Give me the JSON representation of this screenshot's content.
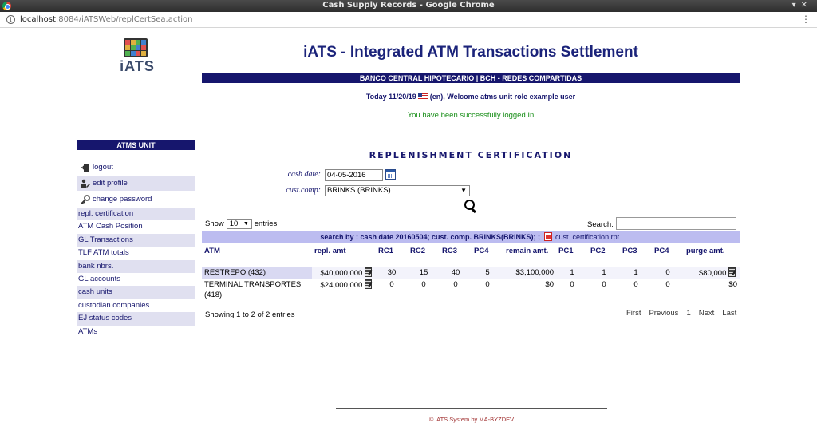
{
  "window": {
    "title": "Cash Supply Records - Google Chrome",
    "url_host": "localhost",
    "url_path": ":8084/iATSWeb/replCertSea.action"
  },
  "logo": {
    "text": "iATS"
  },
  "header": {
    "app_title": "iATS - Integrated ATM Transactions Settlement",
    "bank": "BANCO CENTRAL HIPOTECARIO | BCH - REDES COMPARTIDAS",
    "welcome_prefix": "Today 11/20/19",
    "welcome_suffix": "(en), Welcome atms unit role example user",
    "success_message": "You have been successfully logged In"
  },
  "sidebar": {
    "heading": "ATMS UNIT",
    "actions": [
      {
        "label": "logout",
        "icon": "logout-icon"
      },
      {
        "label": "edit profile",
        "icon": "user-edit-icon"
      },
      {
        "label": "change password",
        "icon": "key-icon"
      }
    ],
    "items": [
      "repl. certification",
      "ATM Cash Position",
      "GL Transactions",
      "TLF ATM totals",
      "bank nbrs.",
      "GL accounts",
      "cash units",
      "custodian companies",
      "EJ status codes",
      "ATMs"
    ]
  },
  "main": {
    "section_title": "REPLENISHMENT CERTIFICATION",
    "form": {
      "cash_date_label": "cash date:",
      "cash_date_value": "04-05-2016",
      "cust_comp_label": "cust.comp:",
      "cust_comp_value": "BRINKS (BRINKS)"
    },
    "table_controls": {
      "show_label": "Show",
      "page_size": "10",
      "entries_label": "entries",
      "search_label": "Search:",
      "search_value": ""
    },
    "criteria": {
      "text": "search by : cash date 20160504; cust. comp. BRINKS(BRINKS); ;",
      "report_link": "cust. certification rpt."
    },
    "columns": [
      "ATM",
      "repl. amt",
      "RC1",
      "RC2",
      "RC3",
      "PC4",
      "remain amt.",
      "PC1",
      "PC2",
      "PC3",
      "PC4",
      "purge amt."
    ],
    "rows": [
      {
        "atm": "RESTREPO (432)",
        "repl_amt": "$40,000,000",
        "rc1": "30",
        "rc2": "15",
        "rc3": "40",
        "rc4": "5",
        "remain_amt": "$3,100,000",
        "pc1": "1",
        "pc2": "1",
        "pc3": "1",
        "pc4": "0",
        "purge_amt": "$80,000"
      },
      {
        "atm": "TERMINAL TRANSPORTES (418)",
        "repl_amt": "$24,000,000",
        "rc1": "0",
        "rc2": "0",
        "rc3": "0",
        "rc4": "0",
        "remain_amt": "$0",
        "pc1": "0",
        "pc2": "0",
        "pc3": "0",
        "pc4": "0",
        "purge_amt": "$0"
      }
    ],
    "info": "Showing 1 to 2 of 2 entries",
    "pager": {
      "first": "First",
      "previous": "Previous",
      "page": "1",
      "next": "Next",
      "last": "Last"
    }
  },
  "footer": {
    "text": "© iATS System by MA-BYZDEV"
  }
}
